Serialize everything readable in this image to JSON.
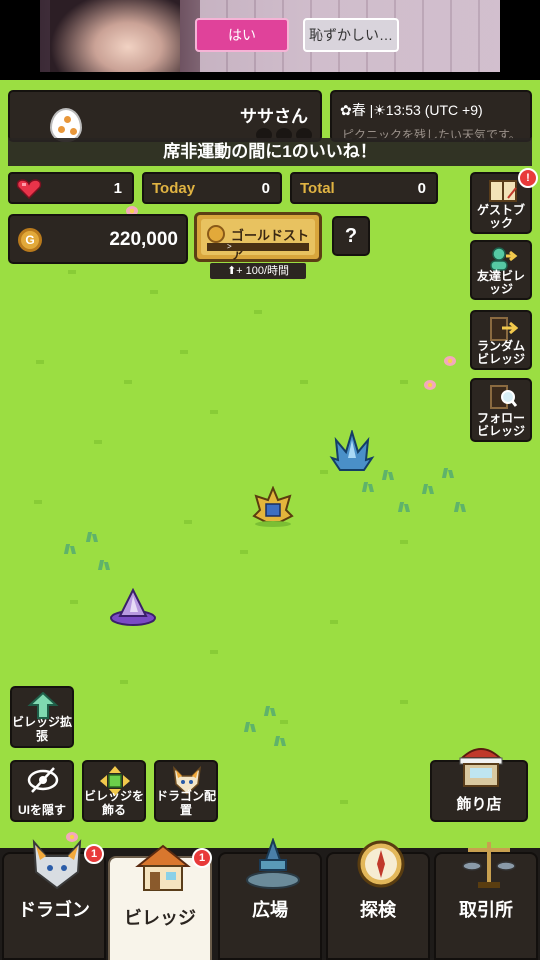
{
  "ad": {
    "yes_label": "はい",
    "no_label": "恥ずかしい…"
  },
  "profile": {
    "name": "ササさん"
  },
  "weather": {
    "line": "✿春 |☀13:53 (UTC +9)",
    "sub": "ピクニックを残したい天気です。"
  },
  "notice": "席非運動の間に1のいいね！",
  "stats": {
    "likes": "1",
    "today_label": "Today",
    "today_value": "0",
    "total_label": "Total",
    "total_value": "0"
  },
  "gold": {
    "amount": "220,000",
    "coin_symbol": "G",
    "store_label": "ゴールドストア",
    "store_arrow": ">",
    "rate": "⬆+ 100/時間",
    "help": "?"
  },
  "side_buttons": [
    {
      "label": "ゲストブック",
      "icon": "guestbook-icon",
      "badge": "!"
    },
    {
      "label": "友達ビレッジ",
      "icon": "friend-village-icon"
    },
    {
      "label": "ランダムビレッジ",
      "icon": "random-village-icon"
    },
    {
      "label": "フォロービレッジ",
      "icon": "follow-village-icon"
    }
  ],
  "util_buttons": {
    "expand": "ビレッジ拡張",
    "hide_ui": "UIを隠す",
    "decorate": "ビレッジを飾る",
    "place_dragon": "ドラゴン配置"
  },
  "shop": {
    "label": "飾り店"
  },
  "nav": {
    "tabs": [
      {
        "label": "ドラゴン",
        "badge": "1"
      },
      {
        "label": "ビレッジ",
        "badge": "1",
        "active": true
      },
      {
        "label": "広場"
      },
      {
        "label": "探検"
      },
      {
        "label": "取引所"
      }
    ]
  },
  "colors": {
    "grass": "#9bde42",
    "panel": "#2c2621",
    "accent_gold": "#e0b342",
    "badge_red": "#e83a3a"
  }
}
